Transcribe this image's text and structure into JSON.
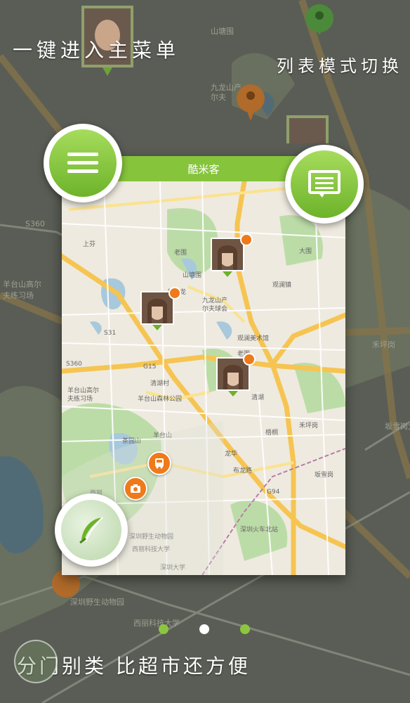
{
  "captions": {
    "menu": "一键进入主菜单",
    "list_switch": "列表模式切换",
    "category": "分门别类 比超市还方便"
  },
  "app": {
    "title": "酷米客"
  },
  "icons": {
    "menu": "hamburger-menu-icon",
    "list": "list-mode-icon",
    "write": "feather-quill-icon",
    "bus": "bus-icon",
    "camera": "camera-icon"
  },
  "map_labels": {
    "bg": [
      "山塘围",
      "九龙山产",
      "尔夫",
      "羊台山高尔",
      "夫练习场",
      "S360",
      "G15",
      "深圳野生动物园",
      "西丽科技大学",
      "禾坪岗",
      "坂雪岗大道"
    ],
    "phone": [
      "上芬",
      "老围",
      "山塘围",
      "井头龙",
      "观澜镇",
      "大围",
      "九龙山产",
      "尔夫球会",
      "观澜美术馆",
      "观澜大道",
      "老围",
      "G15",
      "S31",
      "S360",
      "羊台山高尔",
      "夫练习场",
      "羊台山森林公园",
      "清湖村",
      "清湖",
      "茶园山",
      "羊台山",
      "梧桐",
      "禾坪岗",
      "布龙路",
      "G94",
      "深圳火车北站",
      "深圳野生动物园",
      "西丽科技大学",
      "深圳大学",
      "西丽",
      "龙华",
      "坂雪岗"
    ]
  },
  "pager": {
    "count": 3,
    "active_index": 1
  },
  "colors": {
    "accent": "#86c43c",
    "orange": "#ef7a1a",
    "overlay": "#3f413c"
  }
}
